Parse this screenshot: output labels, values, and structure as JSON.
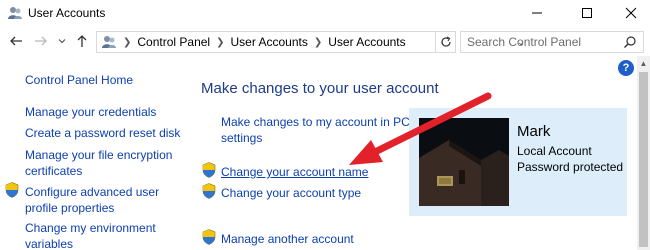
{
  "window": {
    "title": "User Accounts",
    "app_icon": "user-accounts-icon",
    "controls": [
      "minimize-icon",
      "maximize-icon",
      "close-icon"
    ]
  },
  "nav": {
    "back_icon": "arrow-left-icon",
    "forward_icon": "arrow-right-icon",
    "recent_icon": "chevron-down-icon",
    "up_icon": "arrow-up-icon",
    "breadcrumb": [
      "Control Panel",
      "User Accounts",
      "User Accounts"
    ],
    "search_placeholder": "Search Control Panel"
  },
  "sidebar": {
    "home": "Control Panel Home",
    "items": [
      {
        "label_lines": [
          "Manage your credentials"
        ],
        "shield": false
      },
      {
        "label_lines": [
          "Create a password reset disk"
        ],
        "shield": false
      },
      {
        "label_lines": [
          "Manage your file encryption",
          "certificates"
        ],
        "shield": false
      },
      {
        "label_lines": [
          "Configure advanced user",
          "profile properties"
        ],
        "shield": true
      },
      {
        "label_lines": [
          "Change my environment",
          "variables"
        ],
        "shield": false
      }
    ]
  },
  "main": {
    "heading": "Make changes to your user account",
    "pc_settings_link": [
      "Make changes to my account in PC",
      "settings"
    ],
    "change_name_link": "Change your account name",
    "change_type_link": "Change your account type",
    "manage_another_link": "Manage another account"
  },
  "account": {
    "name": "Mark",
    "type": "Local Account",
    "status": "Password protected"
  },
  "help": {
    "label": "?"
  },
  "colors": {
    "link": "#0c3fb0",
    "heading": "#1e3b8a",
    "card_bg": "#ddeefa",
    "annotation_arrow": "#e3212b"
  }
}
